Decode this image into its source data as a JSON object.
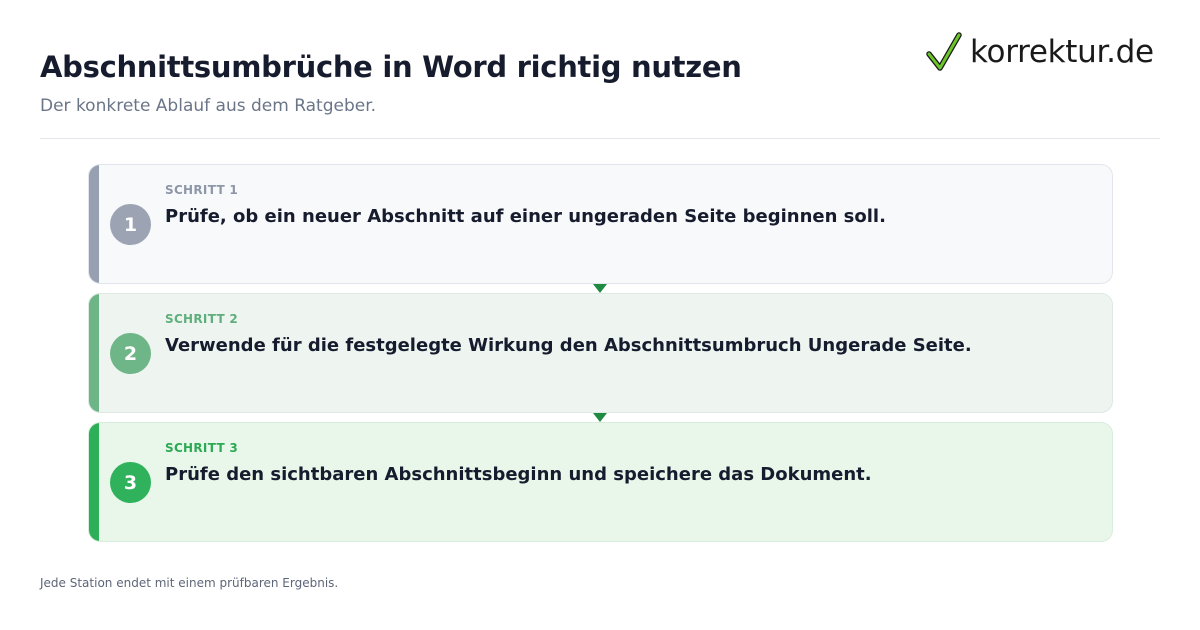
{
  "header": {
    "title": "Abschnittsumbrüche in Word richtig nutzen",
    "subtitle": "Der konkrete Ablauf aus dem Ratgeber."
  },
  "logo": {
    "text": "korrektur.de",
    "icon": "checkmark-icon",
    "accent": "#6cc62a"
  },
  "steps": [
    {
      "number": "1",
      "label": "SCHRITT 1",
      "text": "Prüfe, ob ein neuer Abschnitt auf einer ungeraden Seite beginnen soll.",
      "color": "#9ca4b4"
    },
    {
      "number": "2",
      "label": "SCHRITT 2",
      "text": "Verwende für die festgelegte Wirkung den Abschnittsumbruch Ungerade Seite.",
      "color": "#6eb588"
    },
    {
      "number": "3",
      "label": "SCHRITT 3",
      "text": "Prüfe den sichtbaren Abschnittsbeginn und speichere das Dokument.",
      "color": "#30b15c"
    }
  ],
  "connector_color": "#1e8a42",
  "footer": {
    "note": "Jede Station endet mit einem prüfbaren Ergebnis."
  }
}
